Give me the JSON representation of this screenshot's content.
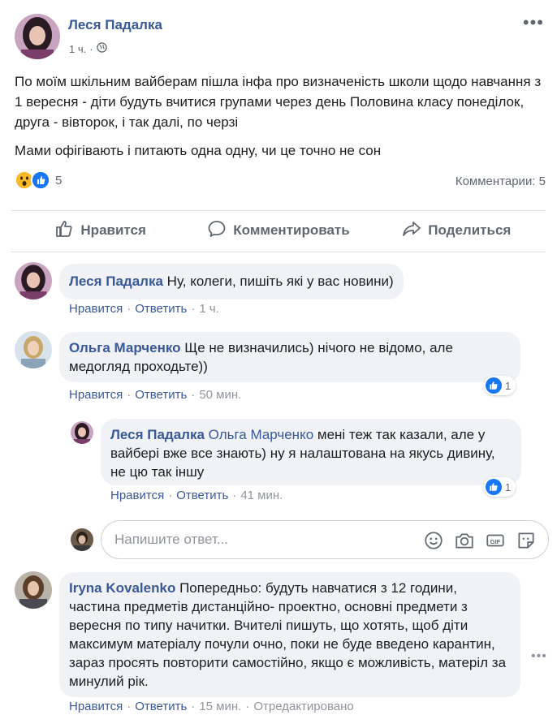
{
  "post": {
    "author": "Леся Падалка",
    "time": "1 ч.",
    "paragraphs": [
      "По моїм шкільним вайберам пішла інфа про визначеність школи щодо навчання з 1 вересня - діти будуть вчитися групами через день Половина класу понеділок, друга - вівторок, і так далі, по черзі",
      "Мами офігівають і питають одна одну, чи це точно не сон"
    ],
    "reaction_count": "5",
    "comments_label": "Комментарии: 5",
    "actions": {
      "like": "Нравится",
      "comment": "Комментировать",
      "share": "Поделиться"
    }
  },
  "comments": [
    {
      "author": "Леся Падалка",
      "text": "Ну, колеги, пишіть які у вас новини)",
      "like": "Нравится",
      "reply": "Ответить",
      "time": "1 ч."
    },
    {
      "author": "Ольга Марченко",
      "text": "Ще не визначились) нічого не відомо, але медогляд проходьте))",
      "like": "Нравится",
      "reply": "Ответить",
      "time": "50 мин.",
      "likes": "1"
    },
    {
      "author": "Леся Падалка",
      "mention": "Ольга Марченко",
      "text": "мені теж так казали, але у вайбері вже все знають) ну я налаштована на якусь дивину, не цю так іншу",
      "like": "Нравится",
      "reply": "Ответить",
      "time": "41 мин.",
      "likes": "1"
    },
    {
      "author": "Iryna Kovalenko",
      "text": "Попередньо: будуть навчатися з 12 години, частина предметів дистанційно- проектно, основні предмети з вересня по типу начитки. Вчителі пишуть, що хотять, щоб діти максимум матеріалу почули очно, поки не буде введено карантин, зараз просять повторити самостійно, якщо є можливість, матеріл за минулий рік.",
      "like": "Нравится",
      "reply": "Ответить",
      "time": "15 мин.",
      "edited": "Отредактировано"
    }
  ],
  "reply_box": {
    "placeholder": "Напишите ответ..."
  },
  "colors": {
    "link": "#385898",
    "bubble": "#f0f2f5",
    "like_blue": "#1877f2"
  }
}
